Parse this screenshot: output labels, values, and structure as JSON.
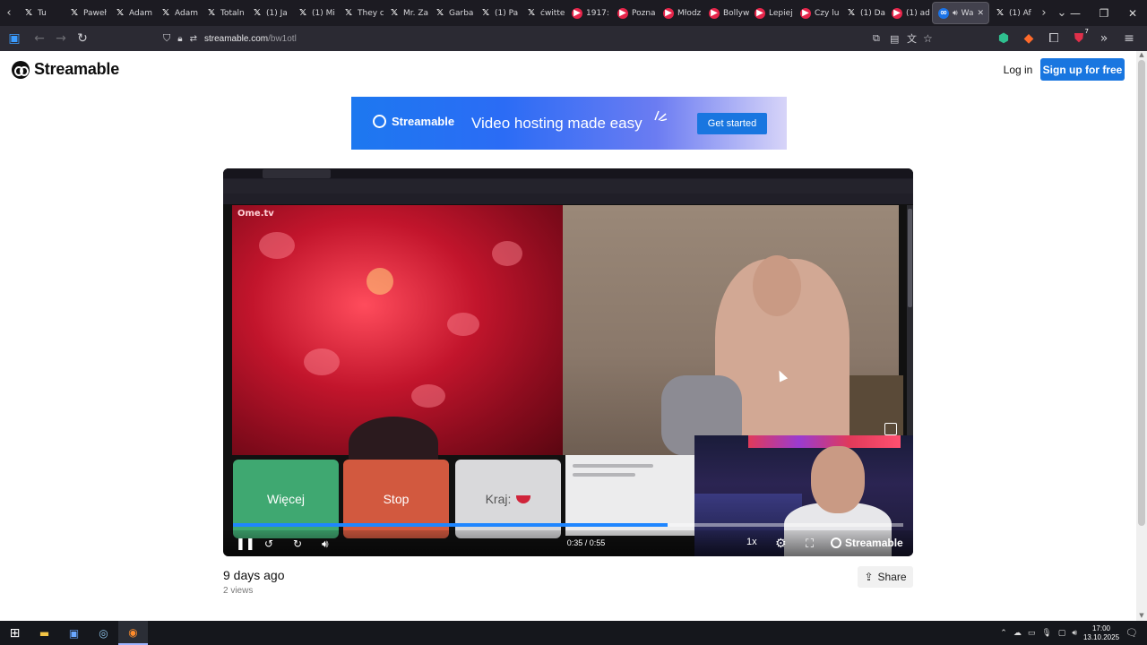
{
  "browser": {
    "tabs": [
      {
        "label": "Tu",
        "icon": "x-logo-icon"
      },
      {
        "label": "Paweł",
        "icon": "x-logo-icon"
      },
      {
        "label": "Adam",
        "icon": "x-logo-icon"
      },
      {
        "label": "Adam",
        "icon": "x-logo-icon"
      },
      {
        "label": "Totaln",
        "icon": "x-logo-icon"
      },
      {
        "label": "(1) Ja",
        "icon": "x-logo-icon"
      },
      {
        "label": "(1) Mi",
        "icon": "x-logo-icon"
      },
      {
        "label": "They c",
        "icon": "x-logo-icon"
      },
      {
        "label": "Mr. Za",
        "icon": "x-logo-icon"
      },
      {
        "label": "Garba",
        "icon": "x-logo-icon"
      },
      {
        "label": "(1) Pa",
        "icon": "x-logo-icon"
      },
      {
        "label": "ćwitte",
        "icon": "x-logo-icon"
      },
      {
        "label": "1917:",
        "icon": "youtube-icon"
      },
      {
        "label": "Pozna",
        "icon": "youtube-icon"
      },
      {
        "label": "Młodz",
        "icon": "youtube-icon"
      },
      {
        "label": "Bollyw",
        "icon": "youtube-icon"
      },
      {
        "label": "Lepiej",
        "icon": "youtube-icon"
      },
      {
        "label": "Czy lu",
        "icon": "youtube-icon"
      },
      {
        "label": "(1) Da",
        "icon": "x-logo-icon"
      },
      {
        "label": "(1) ad",
        "icon": "youtube-icon"
      },
      {
        "label": "Wa",
        "icon": "streamable-icon",
        "active": true
      },
      {
        "label": "(1) Af",
        "icon": "x-logo-icon"
      }
    ],
    "url_host": "streamable.com",
    "url_path": "/bw1otl",
    "badge_count": "7"
  },
  "site": {
    "brand": "Streamable",
    "login": "Log in",
    "signup": "Sign up for free"
  },
  "banner": {
    "brand": "Streamable",
    "tagline": "Video hosting made easy",
    "cta": "Get started"
  },
  "video": {
    "buttons": {
      "more": "Więcej",
      "stop": "Stop",
      "country": "Kraj:"
    },
    "time": "0:35 / 0:55",
    "progress_fraction": 0.648,
    "speed": "1x",
    "watermark": "Streamable",
    "overlay_brand": "Ome.tv"
  },
  "meta": {
    "posted": "9 days ago",
    "views": "2 views",
    "share": "Share"
  },
  "taskbar": {
    "time": "17:00",
    "date": "13.10.2025"
  }
}
